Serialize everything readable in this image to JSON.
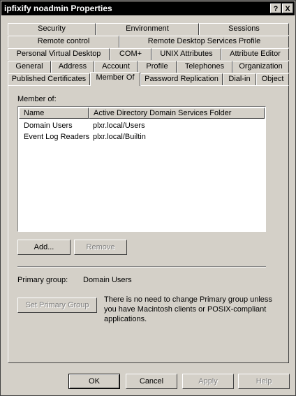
{
  "window": {
    "title": "ipfixify noadmin Properties",
    "help_glyph": "?",
    "close_glyph": "X"
  },
  "tabs": {
    "row1": [
      "Security",
      "Environment",
      "Sessions"
    ],
    "row2": [
      "Remote control",
      "Remote Desktop Services Profile"
    ],
    "row3": [
      "Personal Virtual Desktop",
      "COM+",
      "UNIX Attributes",
      "Attribute Editor"
    ],
    "row4": [
      "General",
      "Address",
      "Account",
      "Profile",
      "Telephones",
      "Organization"
    ],
    "row5": [
      "Published Certificates",
      "Member Of",
      "Password Replication",
      "Dial-in",
      "Object"
    ],
    "active": "Member Of"
  },
  "member_of": {
    "label": "Member of:",
    "columns": [
      "Name",
      "Active Directory Domain Services Folder"
    ],
    "rows": [
      {
        "name": "Domain Users",
        "folder": "plxr.local/Users"
      },
      {
        "name": "Event Log Readers",
        "folder": "plxr.local/Builtin"
      }
    ],
    "add_label": "Add...",
    "remove_label": "Remove"
  },
  "primary_group": {
    "label": "Primary group:",
    "value": "Domain Users",
    "set_button_label": "Set Primary Group",
    "note_line1": "There is no need to change Primary group unless",
    "note_line2": "you have Macintosh clients or POSIX-compliant",
    "note_line3": "applications."
  },
  "footer": {
    "ok_label": "OK",
    "cancel_label": "Cancel",
    "apply_label": "Apply",
    "help_label": "Help"
  }
}
